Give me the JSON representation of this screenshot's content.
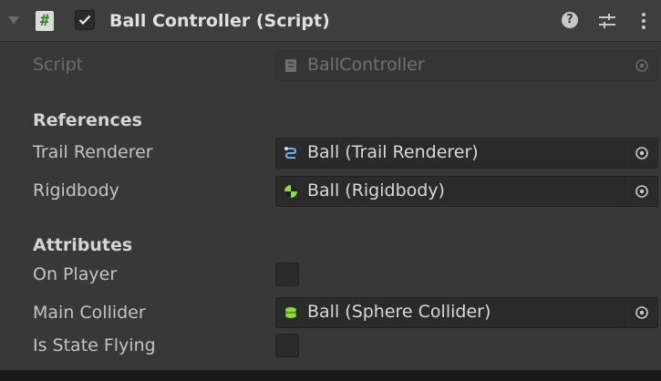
{
  "component": {
    "title": "Ball Controller (Script)",
    "enabled": true,
    "script": {
      "label": "Script",
      "value": "BallController"
    }
  },
  "sections": {
    "references": "References",
    "attributes": "Attributes"
  },
  "fields": {
    "trail_renderer": {
      "label": "Trail Renderer",
      "value": "Ball (Trail Renderer)",
      "icon": "trail-renderer-icon"
    },
    "rigidbody": {
      "label": "Rigidbody",
      "value": "Ball (Rigidbody)",
      "icon": "rigidbody-icon"
    },
    "on_player": {
      "label": "On Player",
      "checked": false
    },
    "main_collider": {
      "label": "Main Collider",
      "value": "Ball (Sphere Collider)",
      "icon": "sphere-collider-icon"
    },
    "is_state_flying": {
      "label": "Is State Flying",
      "checked": false
    }
  },
  "colors": {
    "background": "#383838",
    "header": "#3e3e3e",
    "field": "#2a2a2a",
    "rigidbody_icon": "#8cdc3c",
    "collider_icon": "#8cdc3c"
  }
}
